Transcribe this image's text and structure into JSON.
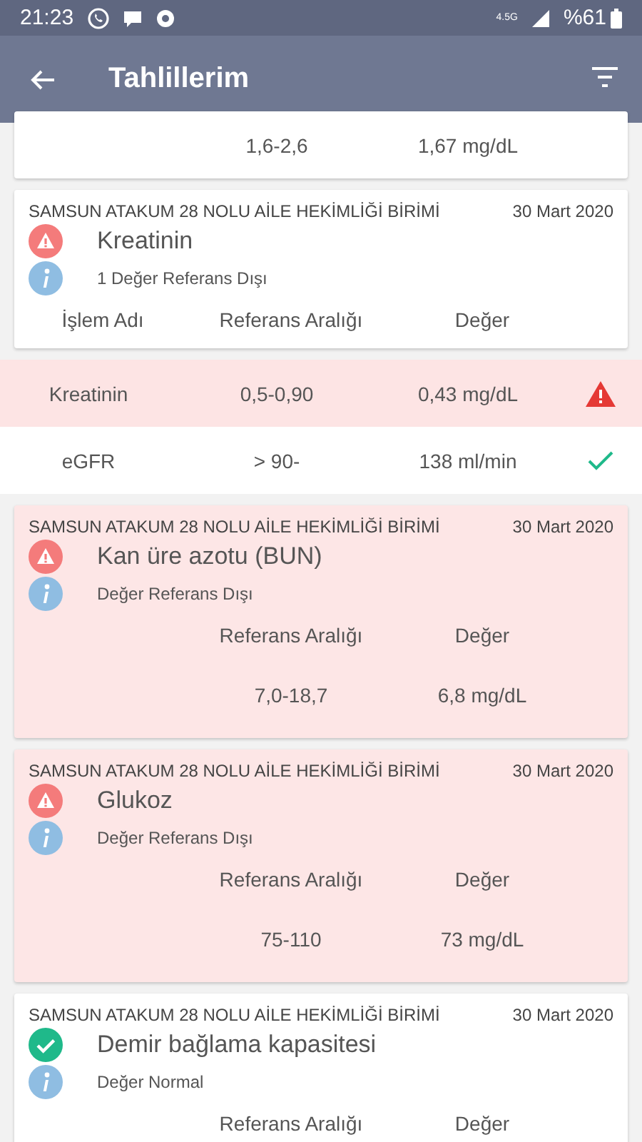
{
  "status_bar": {
    "time": "21:23",
    "network": "4.5G",
    "battery": "%61"
  },
  "app_bar": {
    "title": "Tahlillerim"
  },
  "cards": [
    {
      "kind": "partial",
      "rows": [
        {
          "range": "1,6-2,6",
          "value": "1,67 mg/dL"
        }
      ]
    },
    {
      "kind": "detail",
      "institution": "SAMSUN ATAKUM 28 NOLU AİLE HEKİMLİĞİ BİRİMİ",
      "date": "30 Mart 2020",
      "out_of_range": true,
      "test": "Kreatinin",
      "info": "1 Değer Referans Dışı",
      "headers": [
        "İşlem Adı",
        "Referans Aralığı",
        "Değer"
      ],
      "rows": [
        {
          "name": "Kreatinin",
          "range": "0,5-0,90",
          "value": "0,43 mg/dL",
          "out_of_range": true
        },
        {
          "name": "eGFR",
          "range": "> 90-",
          "value": "138 ml/min",
          "out_of_range": false
        }
      ]
    },
    {
      "kind": "summary",
      "institution": "SAMSUN ATAKUM 28 NOLU AİLE HEKİMLİĞİ BİRİMİ",
      "date": "30 Mart 2020",
      "out_of_range": true,
      "test": "Kan üre azotu (BUN)",
      "info": "Değer Referans Dışı",
      "headers": [
        "Referans Aralığı",
        "Değer"
      ],
      "rows": [
        {
          "range": "7,0-18,7",
          "value": "6,8 mg/dL"
        }
      ]
    },
    {
      "kind": "summary",
      "institution": "SAMSUN ATAKUM 28 NOLU AİLE HEKİMLİĞİ BİRİMİ",
      "date": "30 Mart 2020",
      "out_of_range": true,
      "test": "Glukoz",
      "info": "Değer Referans Dışı",
      "headers": [
        "Referans Aralığı",
        "Değer"
      ],
      "rows": [
        {
          "range": "75-110",
          "value": "73 mg/dL"
        }
      ]
    },
    {
      "kind": "summary",
      "institution": "SAMSUN ATAKUM 28 NOLU AİLE HEKİMLİĞİ BİRİMİ",
      "date": "30 Mart 2020",
      "out_of_range": false,
      "test": "Demir bağlama kapasitesi",
      "info": "Değer Normal",
      "headers": [
        "Referans Aralığı",
        "Değer"
      ]
    }
  ]
}
